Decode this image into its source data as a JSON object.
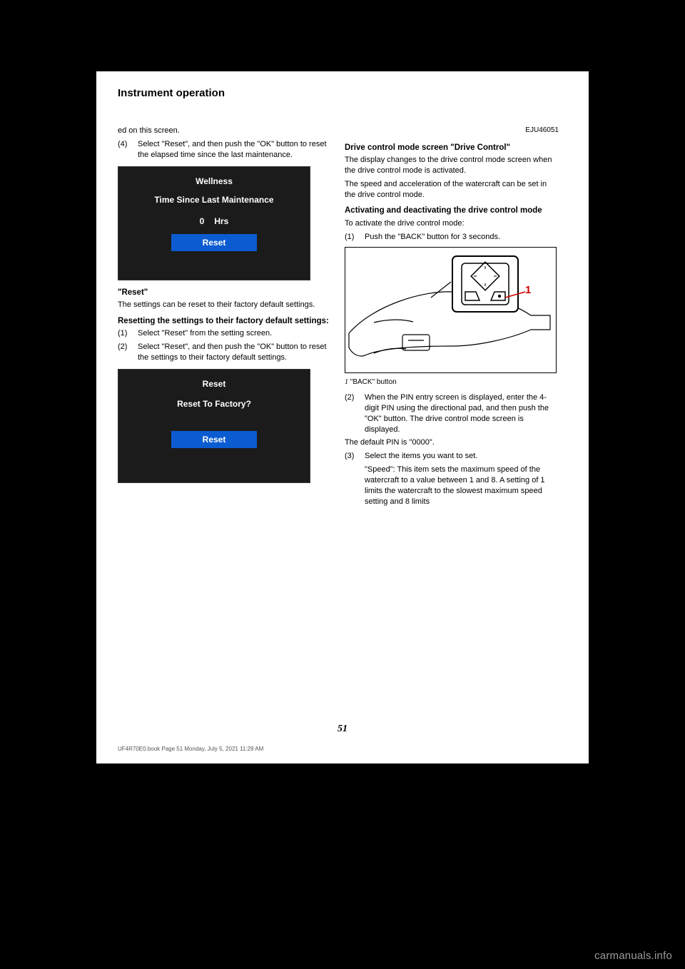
{
  "header": "Instrument operation",
  "page_number_top": "",
  "left": {
    "p1": "ed on this screen.",
    "step4_num": "(4)",
    "step4": "Select \"Reset\", and then push the \"OK\" button to reset the elapsed time since the last maintenance.",
    "wellness_screen": {
      "title": "Wellness",
      "subtitle": "Time Since Last Maintenance",
      "value": "0",
      "unit": "Hrs",
      "button": "Reset"
    },
    "reset_head": "\"Reset\"",
    "reset_p1": "The settings can be reset to their factory default settings.",
    "reset_sub": "Resetting the settings to their factory default settings:",
    "r1_num": "(1)",
    "r1": "Select \"Reset\" from the setting screen.",
    "r2_num": "(2)",
    "r2": "Select \"Reset\", and then push the \"OK\" button to reset the settings to their factory default settings.",
    "reset_screen": {
      "title": "Reset",
      "subtitle": "Reset To Factory?",
      "button": "Reset"
    }
  },
  "right": {
    "heading_code": "EJU46051",
    "heading": "Drive control mode screen \"Drive Control\"",
    "p1": "The display changes to the drive control mode screen when the drive control mode is activated.",
    "p2": "The speed and acceleration of the watercraft can be set in the drive control mode.",
    "p3": "Activating and deactivating the drive control mode",
    "activate_head": "To activate the drive control mode:",
    "a1_num": "(1)",
    "a1": "Push the \"BACK\" button for 3 seconds.",
    "caption_num": "1",
    "caption_text": "\"BACK\" button",
    "a2_num": "(2)",
    "a2": "When the PIN entry screen is displayed, enter the 4-digit PIN using the directional pad, and then push the \"OK\" button. The drive control mode screen is displayed.",
    "a3_pre": "The default PIN is \"0000\".",
    "a3_num": "(3)",
    "a3": "Select the items you want to set.",
    "item_a": "\"Speed\": This item sets the maximum speed of the watercraft to a value between 1 and 8. A setting of 1 limits the watercraft to the slowest maximum speed setting and 8 limits"
  },
  "footer_page": "51",
  "doc_code": "UF4R70E0.book  Page 51  Monday, July 5, 2021  11:29 AM",
  "watermark": "carmanuals.info"
}
